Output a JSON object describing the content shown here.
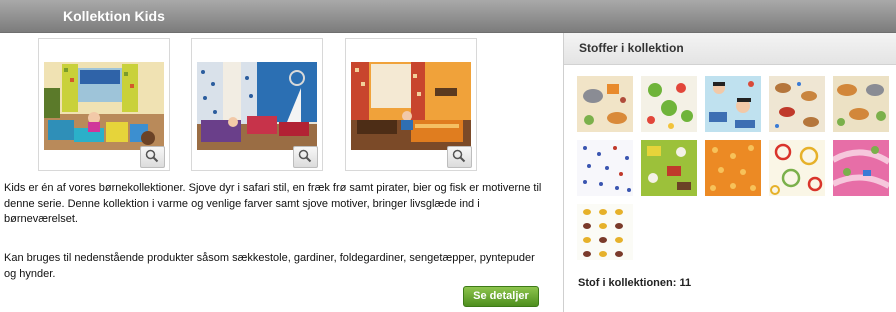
{
  "header": {
    "title": "Kollektion Kids"
  },
  "gallery": {
    "photos": [
      {
        "name": "room-photo-1",
        "zoom_icon": "magnifier-icon"
      },
      {
        "name": "room-photo-2",
        "zoom_icon": "magnifier-icon"
      },
      {
        "name": "room-photo-3",
        "zoom_icon": "magnifier-icon"
      }
    ]
  },
  "description": {
    "paragraph1": "Kids er én af vores børnekollektioner. Sjove dyr i safari stil, en fræk  frø samt pirater, bier og fisk er motiverne til denne serie. Denne kollektion i varme og venlige farver samt sjove motiver, bringer livsglæde ind i børneværelset.",
    "paragraph2": "Kan bruges til nedenstående produkter såsom sækkestole, gardiner, foldegardiner, sengetæpper, pyntepuder og hynder."
  },
  "details_button": {
    "label": "Se detaljer",
    "color": "#5fa22a"
  },
  "fabrics_panel": {
    "title": "Stoffer i kollektion",
    "count_text": "Stof i kollektionen: 11",
    "swatches": [
      {
        "name": "fabric-safari-elephant"
      },
      {
        "name": "fabric-frog"
      },
      {
        "name": "fabric-pirate-blue"
      },
      {
        "name": "fabric-dogs"
      },
      {
        "name": "fabric-safari-beige"
      },
      {
        "name": "fabric-blue-dots"
      },
      {
        "name": "fabric-green-farm"
      },
      {
        "name": "fabric-orange-flowers"
      },
      {
        "name": "fabric-rings"
      },
      {
        "name": "fabric-pink-road"
      },
      {
        "name": "fabric-bees"
      }
    ]
  }
}
